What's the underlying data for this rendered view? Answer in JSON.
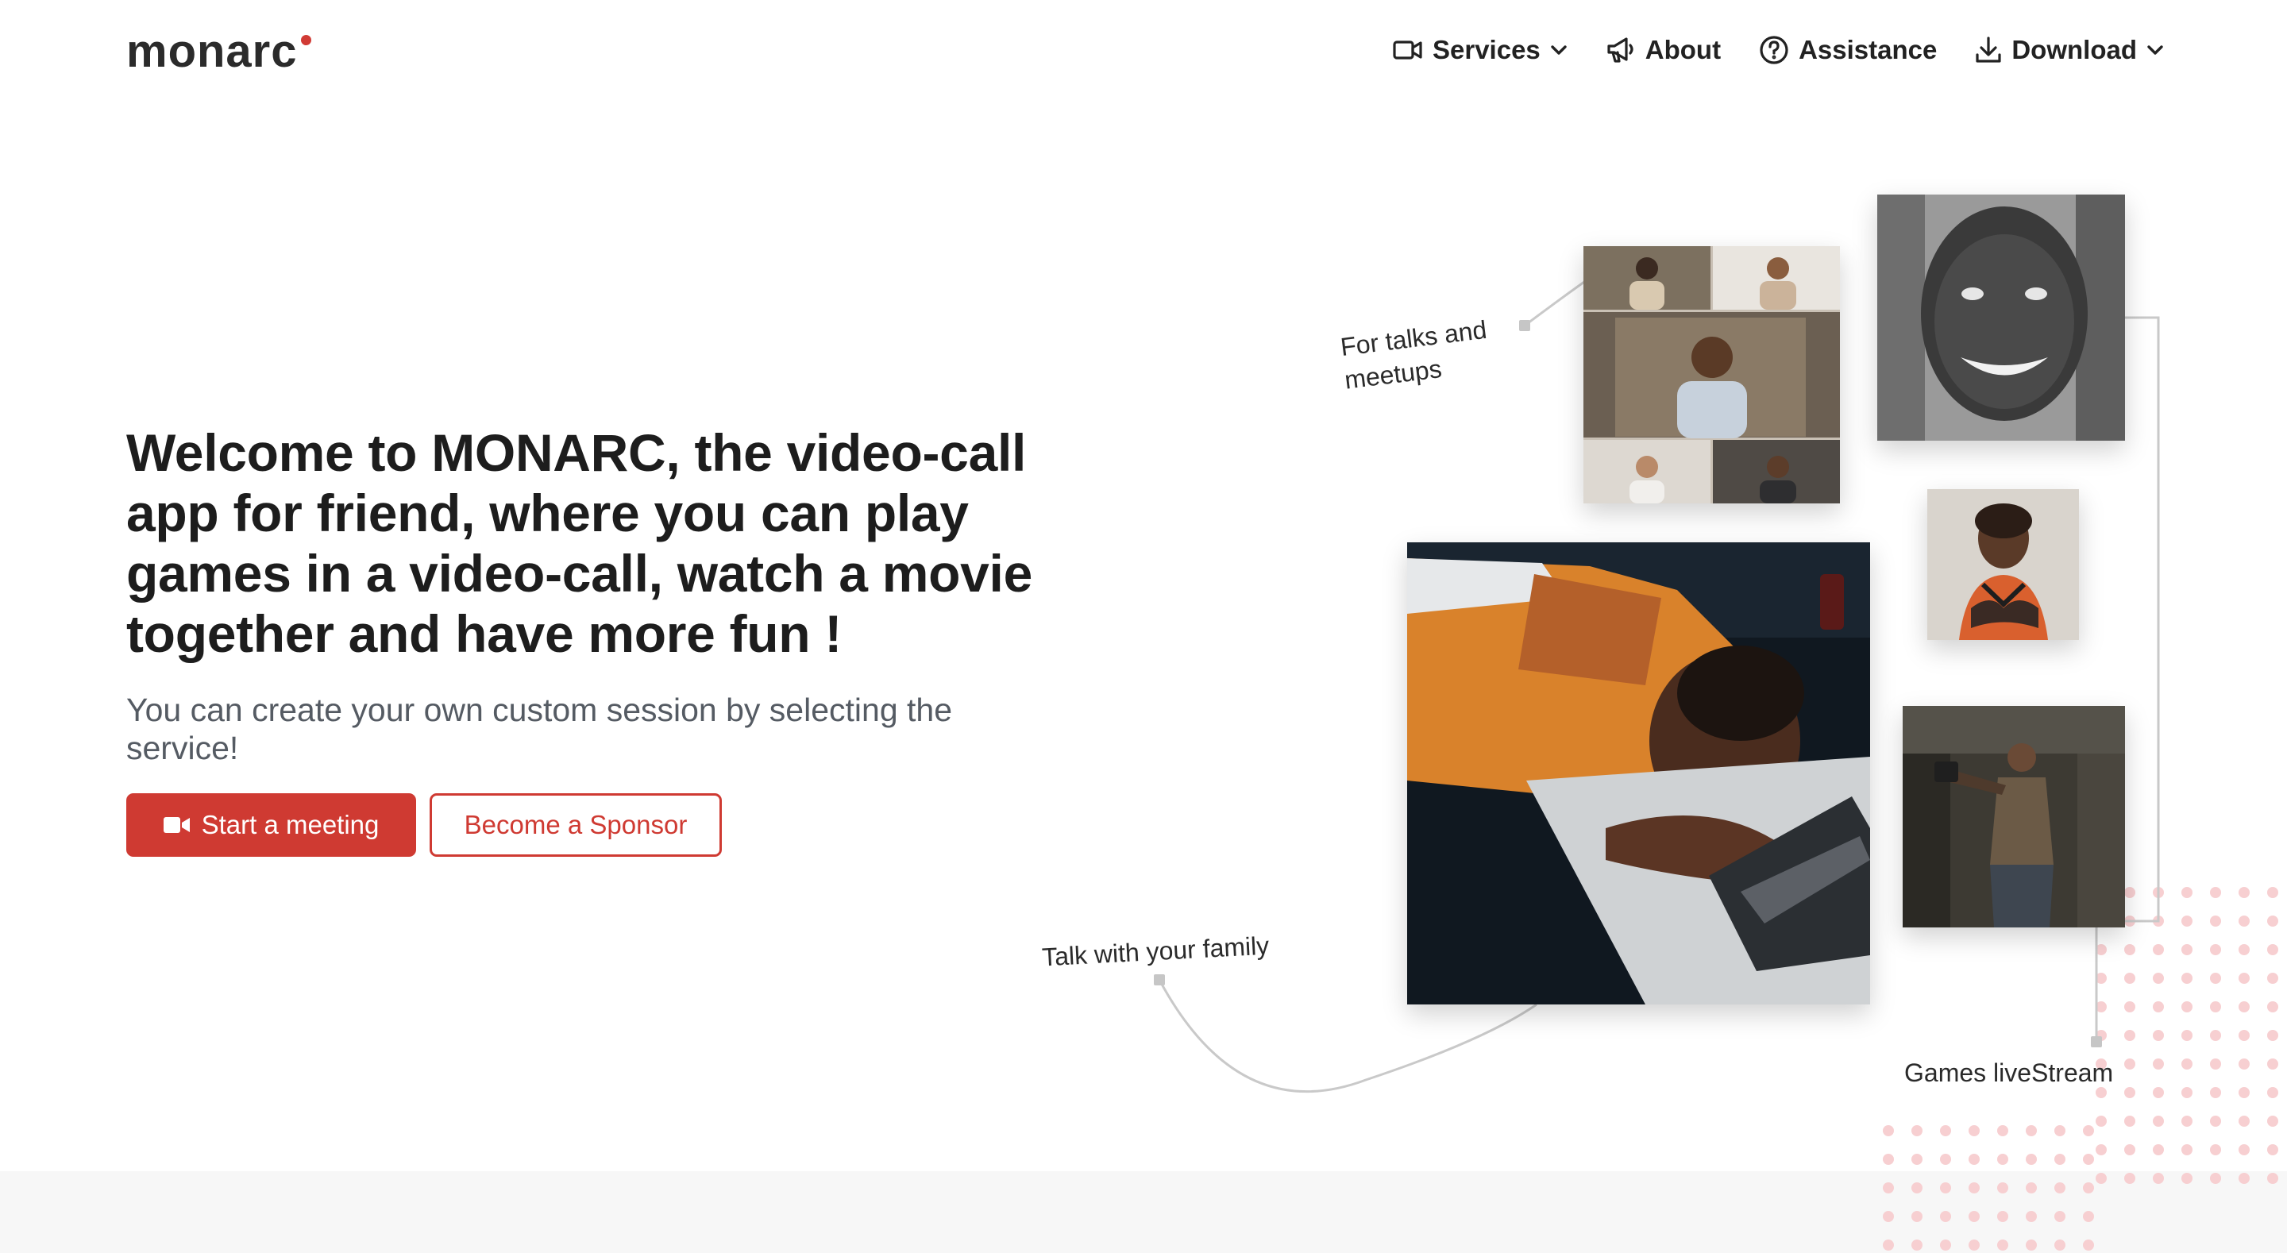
{
  "brand": {
    "name": "monarc",
    "accent": "#d13b35"
  },
  "nav": {
    "items": [
      {
        "label": "Services",
        "icon": "video-camera-icon",
        "dropdown": true
      },
      {
        "label": "About",
        "icon": "megaphone-icon",
        "dropdown": false
      },
      {
        "label": "Assistance",
        "icon": "help-circle-icon",
        "dropdown": false
      },
      {
        "label": "Download",
        "icon": "download-icon",
        "dropdown": true
      }
    ]
  },
  "hero": {
    "title": "Welcome to MONARC, the video-call app for friend, where you can play games in a video-call, watch a movie together and have more fun !",
    "subtitle": "You can create your own custom session by selecting the service!",
    "primary_button": "Start a meeting",
    "secondary_button": "Become a Sponsor"
  },
  "captions": {
    "talks": "For talks and meetups",
    "family": "Talk with your family",
    "games": "Games liveStream"
  },
  "colors": {
    "primary": "#cf3a32",
    "text": "#1d1d1d",
    "muted": "#555b63",
    "band": "#f7f7f7"
  }
}
